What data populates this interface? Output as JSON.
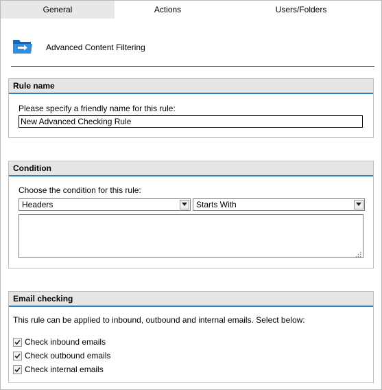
{
  "tabs": [
    {
      "label": "General",
      "active": true
    },
    {
      "label": "Actions",
      "active": false
    },
    {
      "label": "Users/Folders",
      "active": false
    }
  ],
  "header": {
    "title": "Advanced Content Filtering",
    "icon": "folder-arrow-icon"
  },
  "rule_name": {
    "heading": "Rule name",
    "prompt": "Please specify a friendly name for this rule:",
    "value": "New Advanced Checking Rule"
  },
  "condition": {
    "heading": "Condition",
    "prompt": "Choose the condition for this rule:",
    "field_select": "Headers",
    "operator_select": "Starts With",
    "value_text": ""
  },
  "email_checking": {
    "heading": "Email checking",
    "description": "This rule can be applied to inbound, outbound and internal emails. Select below:",
    "options": [
      {
        "label": "Check inbound emails",
        "checked": true
      },
      {
        "label": "Check outbound emails",
        "checked": true
      },
      {
        "label": "Check internal emails",
        "checked": true
      }
    ]
  },
  "colors": {
    "section_accent": "#2f7fbf",
    "tab_active_bg": "#e8e8e8",
    "icon_blue": "#1e7fd0"
  }
}
